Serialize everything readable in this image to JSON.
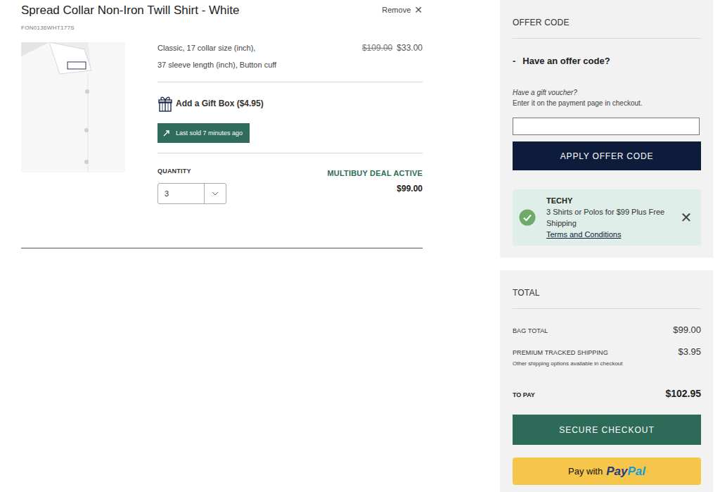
{
  "product": {
    "title": "Spread Collar Non-Iron Twill Shirt - White",
    "sku": "FON0136WHT177S",
    "remove_label": "Remove",
    "remove_icon": "✕",
    "options": [
      "Classic,  17 collar size (inch),",
      "37 sleeve length (inch),  Button cuff"
    ],
    "original_price": "$109.00",
    "price": "$33.00",
    "gift_box_label": "Add a Gift Box  ($4.95)",
    "last_sold": "Last sold 7 minutes ago",
    "quantity_label": "QUANTITY",
    "quantity": "3",
    "deal_label": "MULTIBUY DEAL ACTIVE",
    "deal_total": "$99.00"
  },
  "offer": {
    "heading": "OFFER CODE",
    "toggle": "-",
    "question": "Have an offer code?",
    "voucher_title": "Have a gift voucher?",
    "voucher_note": "Enter it on the payment page in checkout.",
    "input_value": "",
    "button": "APPLY OFFER CODE",
    "applied": {
      "code": "TECHY",
      "description": "3 Shirts or Polos for $99 Plus Free Shipping",
      "terms": "Terms and Conditions",
      "dismiss": "✕"
    }
  },
  "totals": {
    "heading": "TOTAL",
    "rows": [
      {
        "label": "BAG TOTAL",
        "value": "$99.00",
        "note": ""
      },
      {
        "label": "PREMIUM TRACKED SHIPPING",
        "value": "$3.95",
        "note": "Other shipping options available in checkout"
      }
    ],
    "to_pay_label": "TO PAY",
    "to_pay_value": "$102.95",
    "checkout_button": "SECURE CHECKOUT",
    "paypal_prefix": "Pay with",
    "paypal_logo": [
      "Pay",
      "Pal"
    ]
  }
}
